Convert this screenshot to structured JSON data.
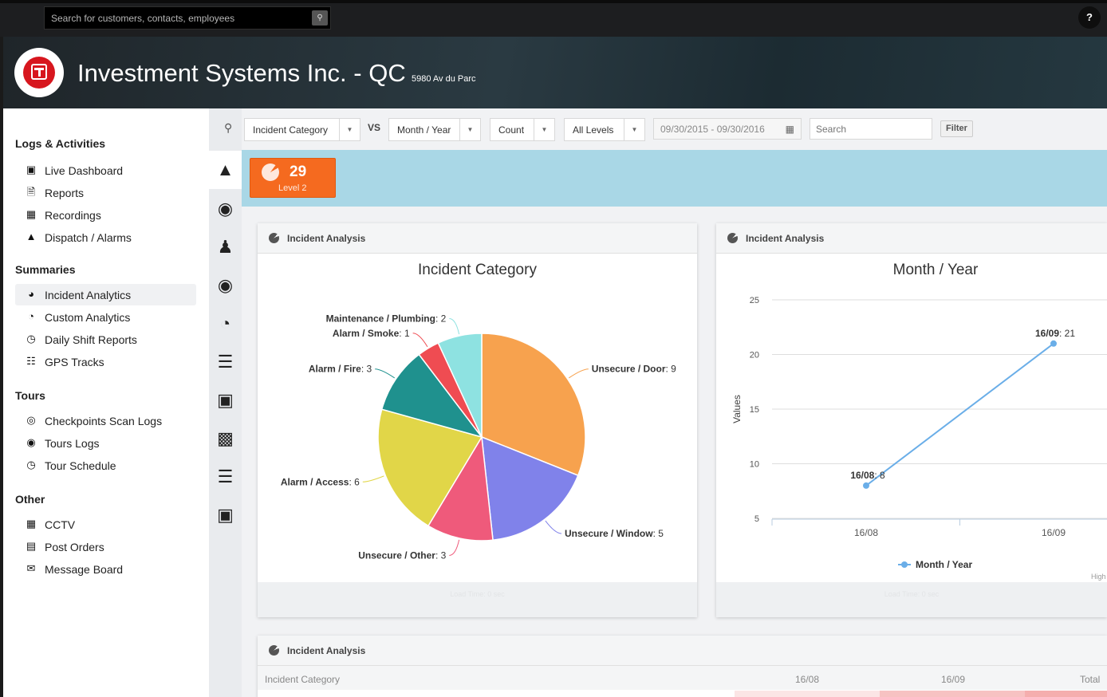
{
  "topbar": {
    "search_placeholder": "Search for customers, contacts, employees",
    "help": "?"
  },
  "header": {
    "company": "Investment Systems Inc. - QC",
    "address": "5980 Av du Parc"
  },
  "sidebar": {
    "sections": [
      {
        "title": "Logs & Activities",
        "items": [
          "Live Dashboard",
          "Reports",
          "Recordings",
          "Dispatch / Alarms"
        ]
      },
      {
        "title": "Summaries",
        "items": [
          "Incident Analytics",
          "Custom Analytics",
          "Daily Shift Reports",
          "GPS Tracks"
        ]
      },
      {
        "title": "Tours",
        "items": [
          "Checkpoints Scan Logs",
          "Tours Logs",
          "Tour Schedule"
        ]
      },
      {
        "title": "Other",
        "items": [
          "CCTV",
          "Post Orders",
          "Message Board"
        ]
      }
    ],
    "active_item": "Incident Analytics"
  },
  "filters": {
    "category": "Incident Category",
    "vs": "VS",
    "period": "Month / Year",
    "metric": "Count",
    "level": "All Levels",
    "date_range": "09/30/2015 - 09/30/2016",
    "search_placeholder": "Search",
    "filter_button": "Filter"
  },
  "level_badge": {
    "count": "29",
    "label": "Level 2",
    "color": "#f56a1f"
  },
  "panels": {
    "pie": {
      "header": "Incident Analysis",
      "footer": "Load Time: 0 sec"
    },
    "line": {
      "header": "Incident Analysis",
      "footer": "Load Time: 0 sec",
      "credit": "High"
    },
    "table": {
      "header": "Incident Analysis",
      "columns": [
        "Incident Category",
        "16/08",
        "16/09",
        "Total"
      ]
    }
  },
  "chart_data": [
    {
      "type": "pie",
      "title": "Incident Category",
      "categories": [
        "Unsecure / Door",
        "Unsecure / Window",
        "Unsecure / Other",
        "Alarm / Access",
        "Alarm / Fire",
        "Alarm / Smoke",
        "Maintenance / Plumbing"
      ],
      "values": [
        9,
        5,
        3,
        6,
        3,
        1,
        2
      ],
      "colors": [
        "#f7a24e",
        "#8082ea",
        "#ef5a7b",
        "#e1d648",
        "#1f918e",
        "#ef4c52",
        "#8ee2e1"
      ]
    },
    {
      "type": "line",
      "title": "Month / Year",
      "categories": [
        "16/08",
        "16/09"
      ],
      "series": [
        {
          "name": "Month / Year",
          "values": [
            8,
            21
          ]
        }
      ],
      "ylabel": "Values",
      "ylim": [
        5,
        25
      ],
      "yticks": [
        5,
        10,
        15,
        20,
        25
      ],
      "color": "#6aaee8",
      "legend": "bottom"
    }
  ]
}
